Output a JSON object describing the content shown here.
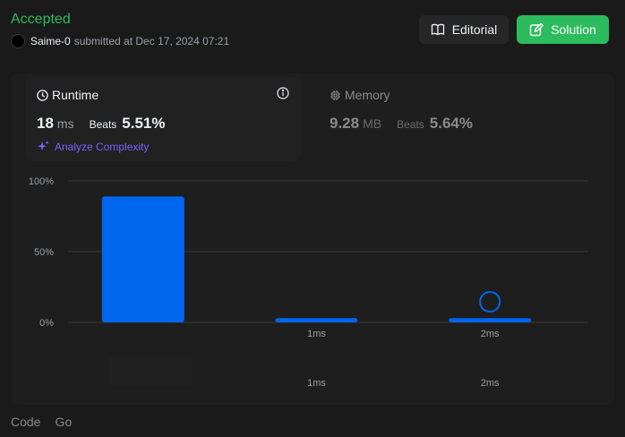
{
  "header": {
    "status": "Accepted",
    "username": "Saime-0",
    "submitted_text": "submitted at Dec 17, 2024 07:21"
  },
  "buttons": {
    "editorial": "Editorial",
    "solution": "Solution"
  },
  "runtime": {
    "title": "Runtime",
    "value": "18",
    "unit": "ms",
    "beats_label": "Beats",
    "beats_pct": "5.51%",
    "analyze_label": "Analyze Complexity"
  },
  "memory": {
    "title": "Memory",
    "value": "9.28",
    "unit": "MB",
    "beats_label": "Beats",
    "beats_pct": "5.64%"
  },
  "chart_data": {
    "type": "bar",
    "categories": [
      "",
      "1ms",
      "2ms"
    ],
    "values": [
      89,
      3,
      3
    ],
    "marker_category": "2ms",
    "ylim": [
      0,
      100
    ],
    "ytick_labels": [
      "100%",
      "50%",
      "0%"
    ],
    "bottom_labels": [
      "",
      "1ms",
      "2ms"
    ],
    "bar_color": "#0066ee",
    "grid": true
  },
  "language_tabs": [
    "Code",
    "Go"
  ],
  "colors": {
    "accepted": "#2cbb5d",
    "solution_bg": "#2cbb5d",
    "analyze": "#7b61ff",
    "bar": "#0066ee"
  }
}
